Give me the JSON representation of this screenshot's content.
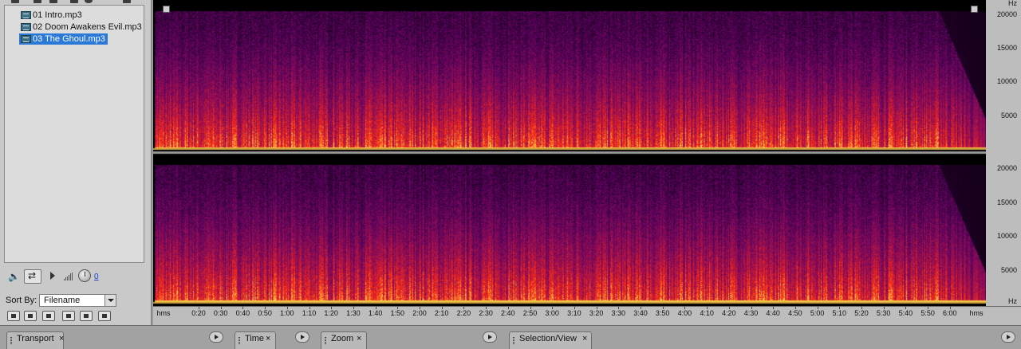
{
  "files": {
    "items": [
      {
        "name": "01 Intro.mp3",
        "selected": false
      },
      {
        "name": "02 Doom Awakens Evil.mp3",
        "selected": false
      },
      {
        "name": "03 The Ghoul.mp3",
        "selected": true
      }
    ]
  },
  "playback": {
    "volume_value": "0"
  },
  "sort": {
    "label": "Sort By:",
    "selected": "Filename"
  },
  "ruler": {
    "unit_left": "hms",
    "unit_right": "hms",
    "ticks": [
      "0:20",
      "0:30",
      "0:40",
      "0:50",
      "1:00",
      "1:10",
      "1:20",
      "1:30",
      "1:40",
      "1:50",
      "2:00",
      "2:10",
      "2:20",
      "2:30",
      "2:40",
      "2:50",
      "3:00",
      "3:10",
      "3:20",
      "3:30",
      "3:40",
      "3:50",
      "4:00",
      "4:10",
      "4:20",
      "4:30",
      "4:40",
      "4:50",
      "5:00",
      "5:10",
      "5:20",
      "5:30",
      "5:40",
      "5:50",
      "6:00"
    ]
  },
  "hz_axis": {
    "unit": "Hz",
    "labels": [
      "20000",
      "15000",
      "10000",
      "5000"
    ]
  },
  "panels": {
    "transport": "Transport",
    "time": "Time",
    "zoom": "Zoom",
    "selection_view": "Selection/View",
    "close": "×"
  },
  "colors": {
    "spectrum_low": "#000000",
    "spectrum_mid": "#5a1a70",
    "spectrum_high": "#e22a10",
    "spectrum_peak": "#ffd24a",
    "selection": "#2a78d8"
  }
}
